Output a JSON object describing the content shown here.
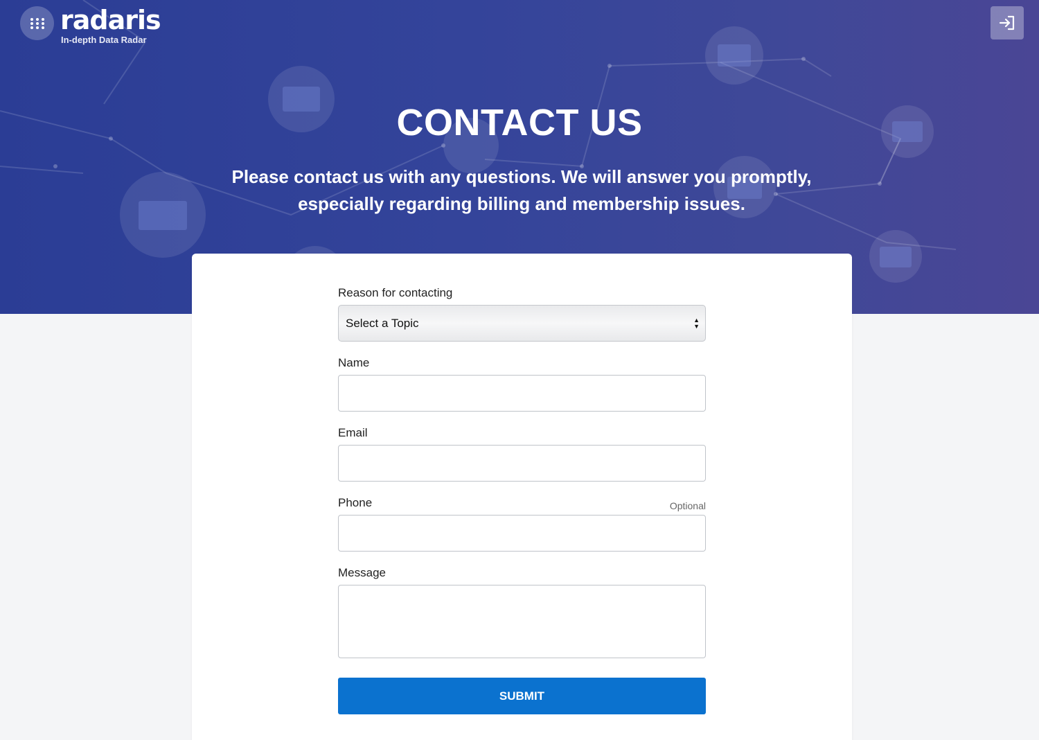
{
  "header": {
    "brand_name": "radaris",
    "brand_tagline": "In-depth Data Radar",
    "menu_icon": "grid-dots-icon",
    "login_icon": "sign-in-icon"
  },
  "hero": {
    "title": "CONTACT US",
    "subtitle": "Please contact us with any questions. We will answer you promptly, especially regarding billing and membership issues."
  },
  "form": {
    "reason_label": "Reason for contacting",
    "reason_selected": "Select a Topic",
    "name_label": "Name",
    "email_label": "Email",
    "phone_label": "Phone",
    "phone_optional": "Optional",
    "message_label": "Message",
    "submit_label": "SUBMIT"
  },
  "colors": {
    "hero_bg": "#2f4098",
    "submit_bg": "#0b72cf",
    "page_bg": "#f4f5f7"
  }
}
